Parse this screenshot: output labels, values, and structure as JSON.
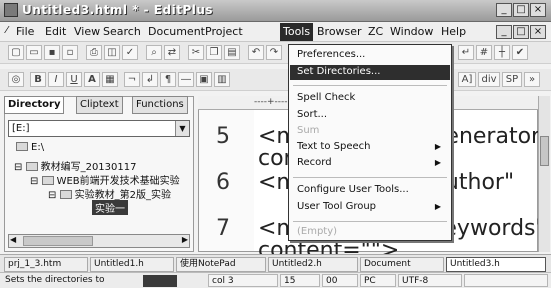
{
  "window": {
    "title": "Untitled3.html * - EditPlus",
    "buttons": [
      "_",
      "□",
      "×"
    ],
    "doc_buttons": [
      "_",
      "□",
      "×"
    ]
  },
  "menu": [
    "File",
    "Edit",
    "View",
    "Search",
    "Document",
    "Project",
    "Tools",
    "Browser",
    "ZC",
    "Window",
    "Help"
  ],
  "toolbar2": {
    "bold": "B",
    "italic": "I",
    "underline": "U",
    "font": "A",
    "extra_right": [
      "A]",
      "div",
      "SP"
    ]
  },
  "sidebar": {
    "tabs": [
      "Directory",
      "Cliptext",
      "Functions"
    ],
    "drive": "[E:]",
    "tree": [
      {
        "label": "E:\\"
      },
      {
        "label": "教材编写_20130117"
      },
      {
        "label": "WEB前端开发技术基础实验"
      },
      {
        "label": "实验教材_第2版_实验"
      },
      {
        "label": "实验一"
      }
    ]
  },
  "editor": {
    "lines": [
      {
        "num": "5",
        "code": "<meta name=\"generator\"",
        "code2": "content=\"\">"
      },
      {
        "num": "6",
        "code": "<meta name=\"author\"",
        "code2": ""
      },
      {
        "num": "7",
        "code": "<meta name=\"keywords\"",
        "code2": "content=\"\">"
      }
    ]
  },
  "tools_menu": {
    "items": [
      {
        "label": "Preferences...",
        "submenu": false,
        "disabled": false,
        "selected": false
      },
      {
        "label": "Set Directories...",
        "submenu": false,
        "disabled": false,
        "selected": true
      },
      {
        "label": "Spell Check",
        "submenu": false,
        "disabled": false,
        "selected": false
      },
      {
        "label": "Sort...",
        "submenu": false,
        "disabled": false,
        "selected": false
      },
      {
        "label": "Sum",
        "submenu": false,
        "disabled": true,
        "selected": false
      },
      {
        "label": "Text to Speech",
        "submenu": true,
        "disabled": false,
        "selected": false
      },
      {
        "label": "Record",
        "submenu": true,
        "disabled": false,
        "selected": false
      },
      {
        "label": "Configure User Tools...",
        "submenu": false,
        "disabled": false,
        "selected": false
      },
      {
        "label": "User Tool Group",
        "submenu": true,
        "disabled": false,
        "selected": false
      },
      {
        "label": "(Empty)",
        "submenu": false,
        "disabled": true,
        "selected": false
      }
    ]
  },
  "file_tabs": [
    "prj_1_3.htm",
    "Untitled1.h",
    "使用NotePad",
    "Untitled2.h",
    "Document",
    "Untitled3.h"
  ],
  "status": {
    "message": "Sets the directories to",
    "col": "col 3",
    "num": "15",
    "b": "00",
    "type": "PC",
    "encoding": "UTF-8"
  }
}
